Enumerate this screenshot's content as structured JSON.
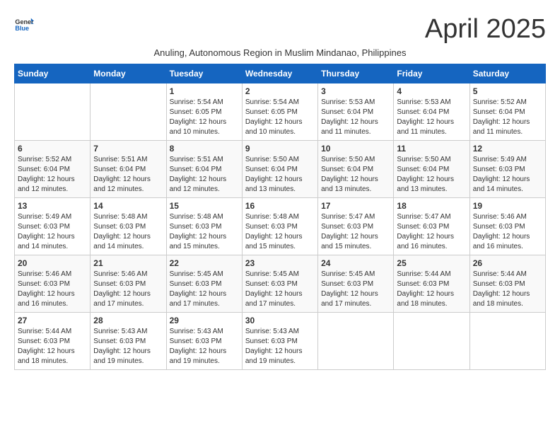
{
  "logo": {
    "text_general": "General",
    "text_blue": "Blue"
  },
  "title": "April 2025",
  "subtitle": "Anuling, Autonomous Region in Muslim Mindanao, Philippines",
  "days_header": [
    "Sunday",
    "Monday",
    "Tuesday",
    "Wednesday",
    "Thursday",
    "Friday",
    "Saturday"
  ],
  "weeks": [
    [
      {
        "day": "",
        "info": ""
      },
      {
        "day": "",
        "info": ""
      },
      {
        "day": "1",
        "info": "Sunrise: 5:54 AM\nSunset: 6:05 PM\nDaylight: 12 hours\nand 10 minutes."
      },
      {
        "day": "2",
        "info": "Sunrise: 5:54 AM\nSunset: 6:05 PM\nDaylight: 12 hours\nand 10 minutes."
      },
      {
        "day": "3",
        "info": "Sunrise: 5:53 AM\nSunset: 6:04 PM\nDaylight: 12 hours\nand 11 minutes."
      },
      {
        "day": "4",
        "info": "Sunrise: 5:53 AM\nSunset: 6:04 PM\nDaylight: 12 hours\nand 11 minutes."
      },
      {
        "day": "5",
        "info": "Sunrise: 5:52 AM\nSunset: 6:04 PM\nDaylight: 12 hours\nand 11 minutes."
      }
    ],
    [
      {
        "day": "6",
        "info": "Sunrise: 5:52 AM\nSunset: 6:04 PM\nDaylight: 12 hours\nand 12 minutes."
      },
      {
        "day": "7",
        "info": "Sunrise: 5:51 AM\nSunset: 6:04 PM\nDaylight: 12 hours\nand 12 minutes."
      },
      {
        "day": "8",
        "info": "Sunrise: 5:51 AM\nSunset: 6:04 PM\nDaylight: 12 hours\nand 12 minutes."
      },
      {
        "day": "9",
        "info": "Sunrise: 5:50 AM\nSunset: 6:04 PM\nDaylight: 12 hours\nand 13 minutes."
      },
      {
        "day": "10",
        "info": "Sunrise: 5:50 AM\nSunset: 6:04 PM\nDaylight: 12 hours\nand 13 minutes."
      },
      {
        "day": "11",
        "info": "Sunrise: 5:50 AM\nSunset: 6:04 PM\nDaylight: 12 hours\nand 13 minutes."
      },
      {
        "day": "12",
        "info": "Sunrise: 5:49 AM\nSunset: 6:03 PM\nDaylight: 12 hours\nand 14 minutes."
      }
    ],
    [
      {
        "day": "13",
        "info": "Sunrise: 5:49 AM\nSunset: 6:03 PM\nDaylight: 12 hours\nand 14 minutes."
      },
      {
        "day": "14",
        "info": "Sunrise: 5:48 AM\nSunset: 6:03 PM\nDaylight: 12 hours\nand 14 minutes."
      },
      {
        "day": "15",
        "info": "Sunrise: 5:48 AM\nSunset: 6:03 PM\nDaylight: 12 hours\nand 15 minutes."
      },
      {
        "day": "16",
        "info": "Sunrise: 5:48 AM\nSunset: 6:03 PM\nDaylight: 12 hours\nand 15 minutes."
      },
      {
        "day": "17",
        "info": "Sunrise: 5:47 AM\nSunset: 6:03 PM\nDaylight: 12 hours\nand 15 minutes."
      },
      {
        "day": "18",
        "info": "Sunrise: 5:47 AM\nSunset: 6:03 PM\nDaylight: 12 hours\nand 16 minutes."
      },
      {
        "day": "19",
        "info": "Sunrise: 5:46 AM\nSunset: 6:03 PM\nDaylight: 12 hours\nand 16 minutes."
      }
    ],
    [
      {
        "day": "20",
        "info": "Sunrise: 5:46 AM\nSunset: 6:03 PM\nDaylight: 12 hours\nand 16 minutes."
      },
      {
        "day": "21",
        "info": "Sunrise: 5:46 AM\nSunset: 6:03 PM\nDaylight: 12 hours\nand 17 minutes."
      },
      {
        "day": "22",
        "info": "Sunrise: 5:45 AM\nSunset: 6:03 PM\nDaylight: 12 hours\nand 17 minutes."
      },
      {
        "day": "23",
        "info": "Sunrise: 5:45 AM\nSunset: 6:03 PM\nDaylight: 12 hours\nand 17 minutes."
      },
      {
        "day": "24",
        "info": "Sunrise: 5:45 AM\nSunset: 6:03 PM\nDaylight: 12 hours\nand 17 minutes."
      },
      {
        "day": "25",
        "info": "Sunrise: 5:44 AM\nSunset: 6:03 PM\nDaylight: 12 hours\nand 18 minutes."
      },
      {
        "day": "26",
        "info": "Sunrise: 5:44 AM\nSunset: 6:03 PM\nDaylight: 12 hours\nand 18 minutes."
      }
    ],
    [
      {
        "day": "27",
        "info": "Sunrise: 5:44 AM\nSunset: 6:03 PM\nDaylight: 12 hours\nand 18 minutes."
      },
      {
        "day": "28",
        "info": "Sunrise: 5:43 AM\nSunset: 6:03 PM\nDaylight: 12 hours\nand 19 minutes."
      },
      {
        "day": "29",
        "info": "Sunrise: 5:43 AM\nSunset: 6:03 PM\nDaylight: 12 hours\nand 19 minutes."
      },
      {
        "day": "30",
        "info": "Sunrise: 5:43 AM\nSunset: 6:03 PM\nDaylight: 12 hours\nand 19 minutes."
      },
      {
        "day": "",
        "info": ""
      },
      {
        "day": "",
        "info": ""
      },
      {
        "day": "",
        "info": ""
      }
    ]
  ]
}
